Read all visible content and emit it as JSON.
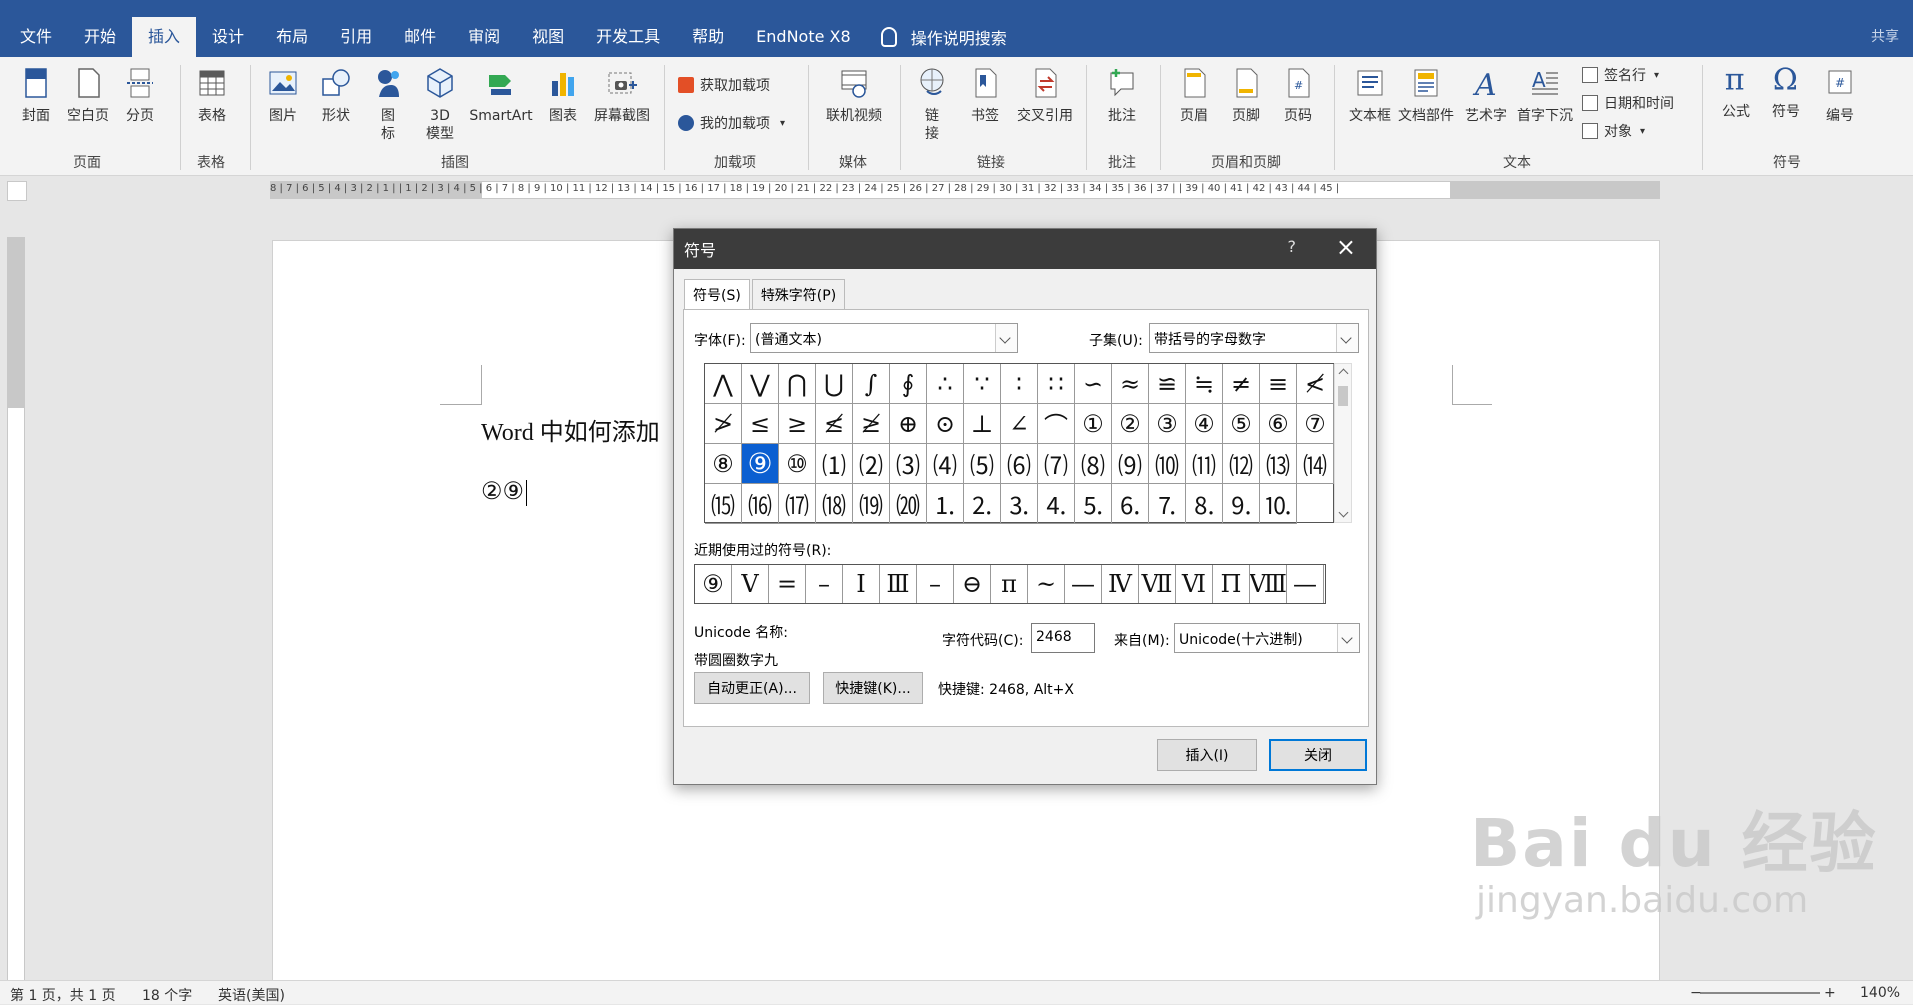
{
  "tabs": [
    "文件",
    "开始",
    "插入",
    "设计",
    "布局",
    "引用",
    "邮件",
    "审阅",
    "视图",
    "开发工具",
    "帮助",
    "EndNote X8"
  ],
  "tellme": "操作说明搜索",
  "share": "共享",
  "ribbon": {
    "pages": {
      "cover": "封面",
      "blank": "空白页",
      "break": "分页",
      "group": "页面"
    },
    "tables": {
      "table": "表格",
      "group": "表格"
    },
    "illustrations": {
      "picture": "图片",
      "shapes": "形状",
      "icons": "图\n标",
      "model3d": "3D\n模型",
      "smartart": "SmartArt",
      "chart": "图表",
      "screenshot": "屏幕截图",
      "group": "插图"
    },
    "addins": {
      "get": "获取加载项",
      "my": "我的加载项",
      "group": "加载项"
    },
    "media": {
      "video": "联机视频",
      "group": "媒体"
    },
    "links": {
      "link": "链\n接",
      "bookmark": "书签",
      "crossref": "交叉引用",
      "group": "链接"
    },
    "comments": {
      "comment": "批注",
      "group": "批注"
    },
    "headerfooter": {
      "header": "页眉",
      "footer": "页脚",
      "pagenum": "页码",
      "group": "页眉和页脚"
    },
    "text": {
      "textbox": "文本框",
      "parts": "文档部件",
      "wordart": "艺术字",
      "dropcap": "首字下沉",
      "signature": "签名行",
      "datetime": "日期和时间",
      "object": "对象",
      "group": "文本"
    },
    "symbols": {
      "equation": "公式",
      "symbol": "符号",
      "number": "编号",
      "group": "符号"
    }
  },
  "ruler": "8 | 7 | 6 | 5 | 4 | 3 | 2 | 1 |   | 1 | 2 | 3 | 4 | 5 | 6 | 7 | 8 | 9 | 10 | 11 | 12 | 13 | 14 | 15 | 16 | 17 | 18 | 19 | 20 | 21 | 22 | 23 | 24 | 25 | 26 | 27 | 28 | 29 | 30 | 31 | 32 | 33 | 34 | 35 | 36 | 37 |   | 39 | 40 | 41 | 42 | 43 | 44 | 45 |",
  "doc": {
    "line1": "Word 中如何添加",
    "line2": "②⑨"
  },
  "dialog": {
    "title": "符号",
    "help": "?",
    "tab_symbols": "符号(S)",
    "tab_special": "特殊字符(P)",
    "font_label": "字体(F):",
    "font_value": "(普通文本)",
    "subset_label": "子集(U):",
    "subset_value": "带括号的字母数字",
    "symbols": [
      "⋀",
      "⋁",
      "⋂",
      "⋃",
      "∫",
      "∮",
      "∴",
      "∵",
      "∶",
      "∷",
      "∽",
      "≈",
      "≌",
      "≒",
      "≠",
      "≡",
      "≮",
      "≯",
      "≤",
      "≥",
      "≰",
      "≱",
      "⊕",
      "⊙",
      "⊥",
      "∠",
      "⌒",
      "①",
      "②",
      "③",
      "④",
      "⑤",
      "⑥",
      "⑦",
      "⑧",
      "⑨",
      "⑩",
      "⑴",
      "⑵",
      "⑶",
      "⑷",
      "⑸",
      "⑹",
      "⑺",
      "⑻",
      "⑼",
      "⑽",
      "⑾",
      "⑿",
      "⒀",
      "⒁",
      "⒂",
      "⒃",
      "⒄",
      "⒅",
      "⒆",
      "⒇",
      "⒈",
      "⒉",
      "⒊",
      "⒋",
      "⒌",
      "⒍",
      "⒎",
      "⒏",
      "⒐",
      "⒑"
    ],
    "selected_index": 35,
    "recent_label": "近期使用过的符号(R):",
    "recent": [
      "⑨",
      "Ⅴ",
      "=",
      "–",
      "Ⅰ",
      "Ⅲ",
      "–",
      "⊖",
      "π",
      "~",
      "—",
      "Ⅳ",
      "Ⅶ",
      "Ⅵ",
      "Π",
      "Ⅷ",
      "—"
    ],
    "unicode_name_label": "Unicode 名称:",
    "unicode_name": "带圆圈数字九",
    "charcode_label": "字符代码(C):",
    "charcode": "2468",
    "from_label": "来自(M):",
    "from_value": "Unicode(十六进制)",
    "autocorrect": "自动更正(A)...",
    "shortcut_btn": "快捷键(K)...",
    "shortcut_text": "快捷键: 2468, Alt+X",
    "insert": "插入(I)",
    "close": "关闭"
  },
  "status": {
    "page": "第 1 页，共 1 页",
    "words": "18 个字",
    "lang": "英语(美国)",
    "zoom": "140%"
  },
  "watermark": {
    "brand": "Bai du 经验",
    "url": "jingyan.baidu.com"
  }
}
